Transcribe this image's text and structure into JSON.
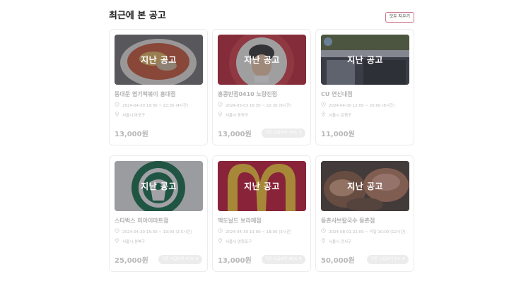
{
  "header": {
    "title": "최근에 본 공고",
    "delete_all_label": "모두 지우기"
  },
  "overlay_label": "지난 공고",
  "cards": [
    {
      "name": "동대문 엽기떡볶이 홍대점",
      "time": "2024-04-30 18:30 ~ 22:30 (4시간)",
      "location": "서울시 마포구",
      "wage": "13,000원",
      "badge": "",
      "thumb": "tteokbokki"
    },
    {
      "name": "홍콩반점0410 노량진점",
      "time": "2024-05-03 16:30 ~ 22:30 (6시간)",
      "location": "서울시 동작구",
      "wage": "13,000원",
      "badge": "기존 시급보다 19% ⬆",
      "thumb": "chef"
    },
    {
      "name": "CU 연신내점",
      "time": "2024-04-30 12:00 ~ 20:00 (8시간)",
      "location": "서울시 은평구",
      "wage": "11,000원",
      "badge": "",
      "thumb": "cu"
    },
    {
      "name": "스타벅스 미아이마트점",
      "time": "2024-04-30 15:30 ~ 19:00 (3.5시간)",
      "location": "서울시 성북구",
      "wage": "25,000원",
      "badge": "기존 시급보다 67% ⬆",
      "thumb": "starbucks"
    },
    {
      "name": "맥도날드 보라매점",
      "time": "2024-04-30 13:00 ~ 18:00 (5시간)",
      "location": "서울시 영등포구",
      "wage": "13,000원",
      "badge": "기존 시급보다 30% ⬆",
      "thumb": "mcdonalds"
    },
    {
      "name": "등촌샤브칼국수 등촌점",
      "time": "2024-08-01 22:00 ~ 익일 10:00 (12시간)",
      "location": "서울시 강서구",
      "wage": "50,000원",
      "badge": "기존 시급보다 1% ⬆",
      "thumb": "shabu"
    }
  ],
  "colors": {
    "delete_border": "#c9748a",
    "muted_text": "#b3b3b3",
    "badge_bg": "#ececec"
  }
}
